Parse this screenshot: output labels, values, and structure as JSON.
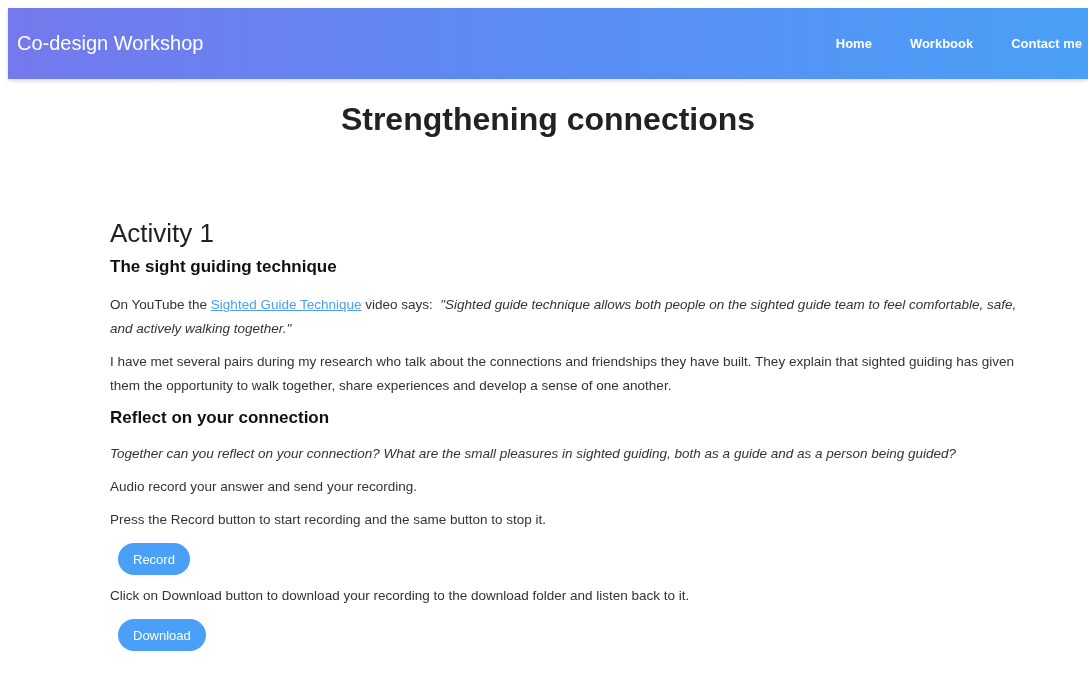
{
  "navbar": {
    "brand": "Co-design Workshop",
    "links": [
      "Home",
      "Workbook",
      "Contact me"
    ]
  },
  "page_title": "Strengthening connections",
  "activity": {
    "heading": "Activity 1",
    "subheading": "The sight guiding technique",
    "intro": {
      "before": "On YouTube the",
      "link": "Sighted Guide Technique",
      "after": "video says:",
      "quote": "\"Sighted guide technique allows both people on the sighted guide team to feel comfortable, safe, and actively walking together.\""
    },
    "paragraph": "I have met several pairs during my research who talk about the connections and friendships they have built. They explain that sighted guiding has given them the opportunity to walk together, share experiences and develop a sense of one another."
  },
  "reflect": {
    "heading": "Reflect on your connection",
    "question": "Together can you reflect on your connection? What are the small pleasures in sighted guiding, both as a guide and as a person being guided?",
    "steps": [
      {
        "kind": "text",
        "text": "Audio record your answer and send your recording."
      },
      {
        "kind": "text",
        "text": "Press the Record button to start recording and the same button to stop it."
      },
      {
        "kind": "button",
        "text": "Record"
      },
      {
        "kind": "text",
        "text": "Click on Download button to download your recording to the download folder and listen back to it."
      },
      {
        "kind": "button",
        "text": "Download"
      }
    ]
  }
}
